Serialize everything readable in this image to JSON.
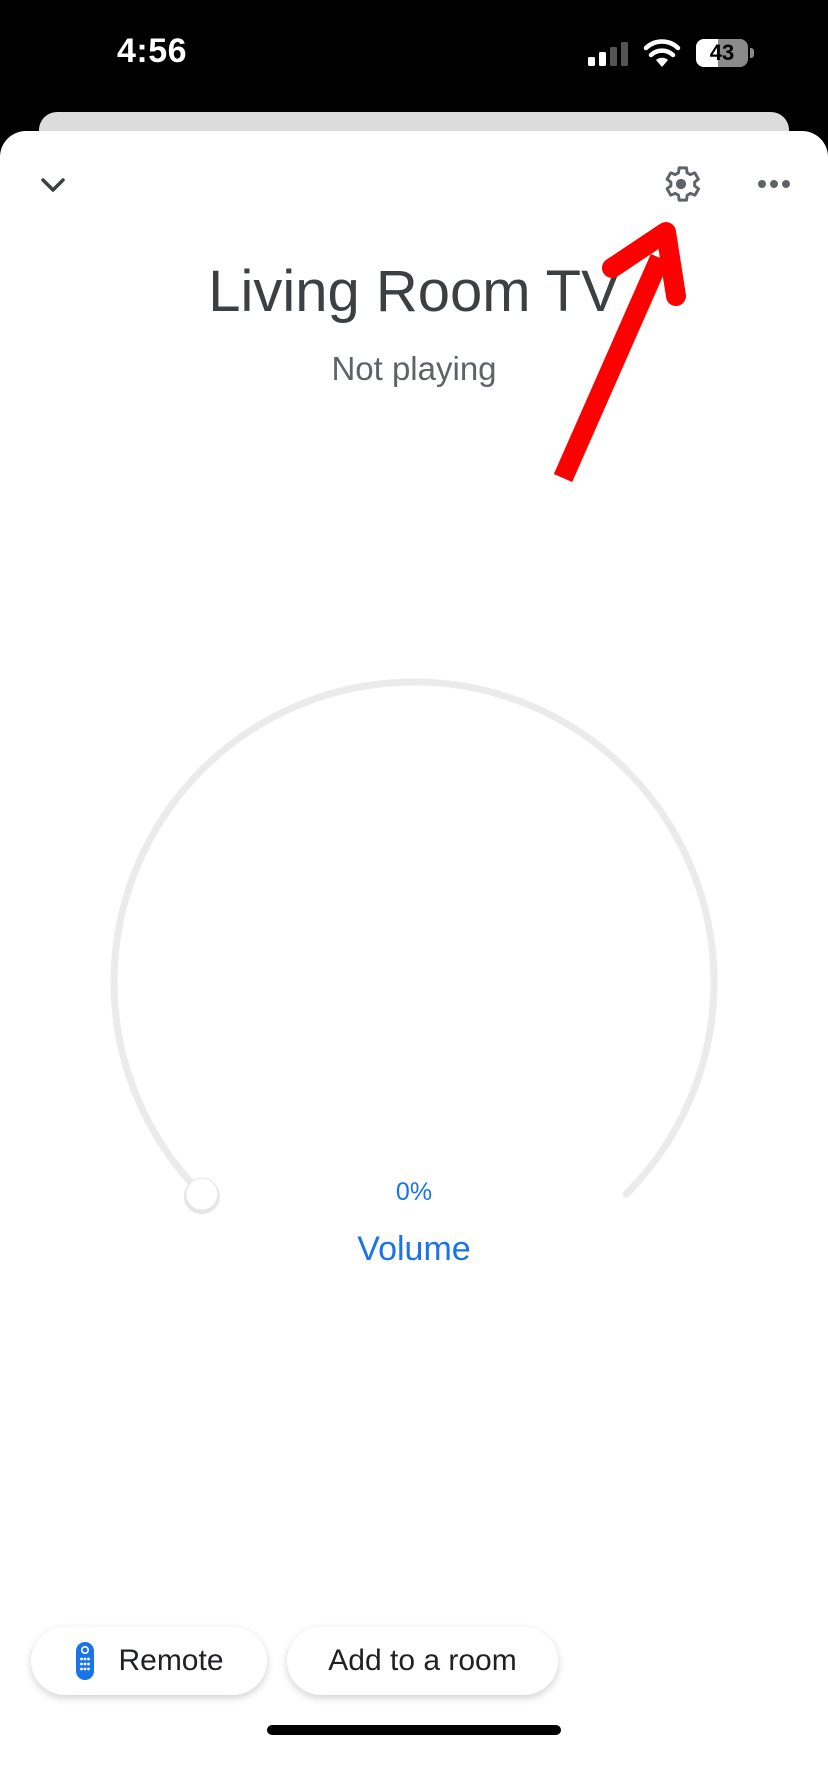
{
  "status_bar": {
    "time": "4:56",
    "battery_level": "43",
    "battery_fraction": 0.43,
    "signal_icon": "cellular-signal-icon",
    "wifi_icon": "wifi-icon"
  },
  "header": {
    "collapse_icon": "chevron-down-icon",
    "settings_icon": "gear-icon",
    "more_icon": "more-horizontal-icon"
  },
  "device": {
    "name": "Living Room TV",
    "status": "Not playing"
  },
  "volume": {
    "value_text": "0%",
    "value_fraction": 0.0,
    "label": "Volume"
  },
  "actions": [
    {
      "label": "Remote",
      "icon": "remote-control-icon"
    },
    {
      "label": "Add to a room"
    }
  ],
  "annotation": {
    "type": "red-arrow",
    "points_to": "settings",
    "color": "#ff0000"
  },
  "colors": {
    "accent": "#1a73e8",
    "title": "#3c4043",
    "subtitle": "#5f6368",
    "track": "#ebebeb"
  }
}
